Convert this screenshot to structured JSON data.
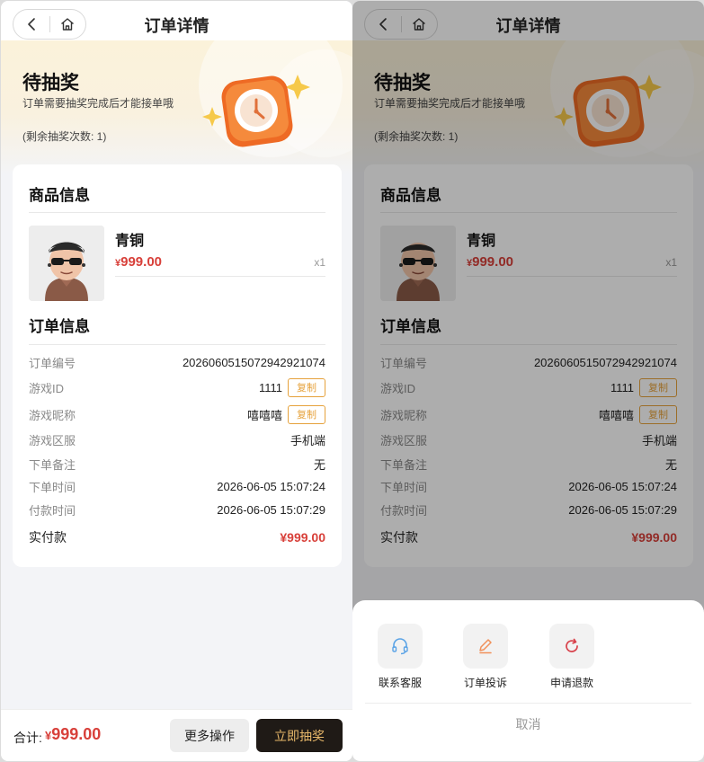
{
  "page": {
    "title": "订单详情",
    "status_title": "待抽奖",
    "status_desc": "订单需要抽奖完成后才能接单哦",
    "remaining": "(剩余抽奖次数: 1)"
  },
  "product_section": {
    "title": "商品信息",
    "name": "青铜",
    "currency": "¥",
    "price": "999.00",
    "qty": "x1"
  },
  "order_section": {
    "title": "订单信息",
    "rows": [
      {
        "label": "订单编号",
        "value": "20260605150729429210​74"
      },
      {
        "label": "游戏ID",
        "value": "1111",
        "copy": "复制"
      },
      {
        "label": "游戏昵称",
        "value": "嘻嘻嘻",
        "copy": "复制"
      },
      {
        "label": "游戏区服",
        "value": "手机端"
      },
      {
        "label": "下单备注",
        "value": "无"
      },
      {
        "label": "下单时间",
        "value": "2026-06-05 15:07:24"
      },
      {
        "label": "付款时间",
        "value": "2026-06-05 15:07:29"
      }
    ],
    "paid_label": "实付款",
    "paid_value": "¥999.00"
  },
  "bottom": {
    "sum_label": "合计:",
    "currency": "¥",
    "sum_value": "999.00",
    "more_label": "更多操作",
    "draw_label": "立即抽奖"
  },
  "sheet": {
    "actions": [
      {
        "label": "联系客服",
        "icon": "headset-icon"
      },
      {
        "label": "订单投诉",
        "icon": "pencil-icon"
      },
      {
        "label": "申请退款",
        "icon": "refresh-icon"
      }
    ],
    "cancel_label": "取消"
  },
  "colors": {
    "price_red": "#d8403a",
    "copy_orange": "#e6a23c",
    "draw_button_bg": "#1f1a16",
    "draw_button_text": "#e8b86a"
  }
}
